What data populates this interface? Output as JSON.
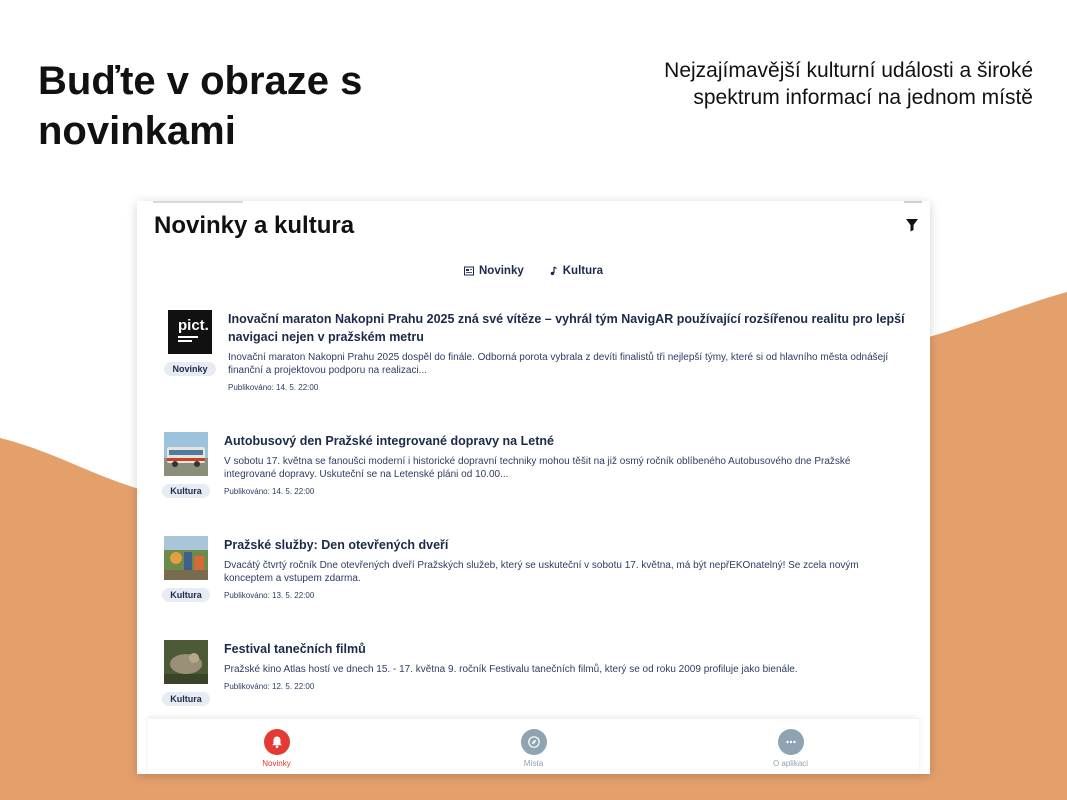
{
  "hero": {
    "title": "Buďte v obraze s novinkami",
    "subtitle": "Nejzajímavější kulturní události a široké spektrum informací na jednom místě"
  },
  "app": {
    "title": "Novinky a kultura",
    "filter_icon": "filter-icon",
    "tabs": [
      {
        "label": "Novinky",
        "icon": "newspaper-icon"
      },
      {
        "label": "Kultura",
        "icon": "music-note-icon"
      }
    ]
  },
  "articles": [
    {
      "title": "Inovační maraton Nakopni Prahu 2025 zná své vítěze – vyhrál tým NavigAR používající rozšířenou realitu pro lepší navigaci nejen v pražském metru",
      "description": "Inovační maraton Nakopni Prahu 2025 dospěl do finále. Odborná porota vybrala z devíti finalistů tři nejlepší týmy, které si od hlavního města odnášejí finanční a projektovou podporu na realizaci...",
      "date": "Publikováno: 14. 5. 22:00",
      "badge": "Novinky",
      "thumb_text": "pict."
    },
    {
      "title": "Autobusový den Pražské integrované dopravy na Letné",
      "description": "V sobotu 17. května se fanoušci moderní i historické dopravní techniky mohou těšit na již osmý ročník oblíbeného Autobusového dne Pražské integrované dopravy. Uskuteční se na Letenské pláni od 10.00...",
      "date": "Publikováno: 14. 5. 22:00",
      "badge": "Kultura"
    },
    {
      "title": "Pražské služby: Den otevřených dveří",
      "description": "Dvacátý čtvrtý ročník Dne otevřených dveří Pražských služeb, který se uskuteční v sobotu 17. května, má být nepřEKOnatelný! Se zcela novým konceptem a vstupem zdarma.",
      "date": "Publikováno: 13. 5. 22:00",
      "badge": "Kultura"
    },
    {
      "title": "Festival tanečních filmů",
      "description": "Pražské kino Atlas hostí ve dnech 15. - 17. května 9. ročník Festivalu tanečních filmů, který se od roku 2009 profiluje jako bienále.",
      "date": "Publikováno: 12. 5. 22:00",
      "badge": "Kultura"
    }
  ],
  "bottom_nav": [
    {
      "label": "Novinky",
      "icon": "bell-icon",
      "active": true,
      "color": "#e53935"
    },
    {
      "label": "Místa",
      "icon": "compass-icon",
      "active": false,
      "color": "#8fa4b3"
    },
    {
      "label": "O aplikaci",
      "icon": "more-icon",
      "active": false,
      "color": "#8fa4b3"
    }
  ],
  "colors": {
    "accent_orange": "#e4a06b",
    "text_navy": "#1b2a4a",
    "active_red": "#e53935",
    "inactive_grey": "#8fa4b3"
  }
}
